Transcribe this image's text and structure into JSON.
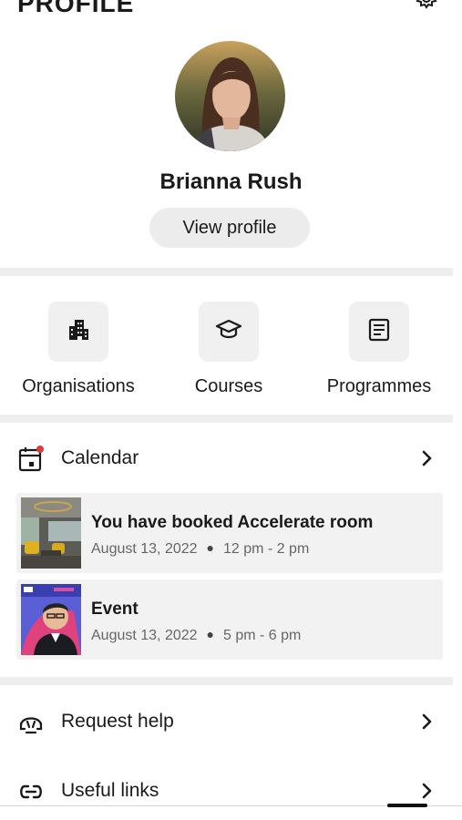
{
  "header": {
    "title": "PROFILE",
    "settings_icon": "gear-icon"
  },
  "profile": {
    "name": "Brianna Rush",
    "view_profile_label": "View profile",
    "avatar_icon": "avatar-photo"
  },
  "shortcuts": [
    {
      "label": "Organisations",
      "icon": "building-icon"
    },
    {
      "label": "Courses",
      "icon": "graduation-cap-icon"
    },
    {
      "label": "Programmes",
      "icon": "document-icon"
    }
  ],
  "calendar": {
    "label": "Calendar",
    "notification_dot_color": "#e53935",
    "events": [
      {
        "title": "You have booked Accelerate room",
        "date": "August 13, 2022",
        "time": "12 pm - 2 pm",
        "thumb": "room-photo"
      },
      {
        "title": "Event",
        "date": "August 13, 2022",
        "time": "5 pm - 6 pm",
        "thumb": "speaker-photo"
      }
    ]
  },
  "menu": [
    {
      "label": "Request help",
      "icon": "headset-icon"
    },
    {
      "label": "Useful links",
      "icon": "link-icon"
    }
  ],
  "colors": {
    "divider": "#eeeeee",
    "tile": "#f0f0f0",
    "card": "#f2f2f2",
    "accent_red": "#e53935"
  }
}
